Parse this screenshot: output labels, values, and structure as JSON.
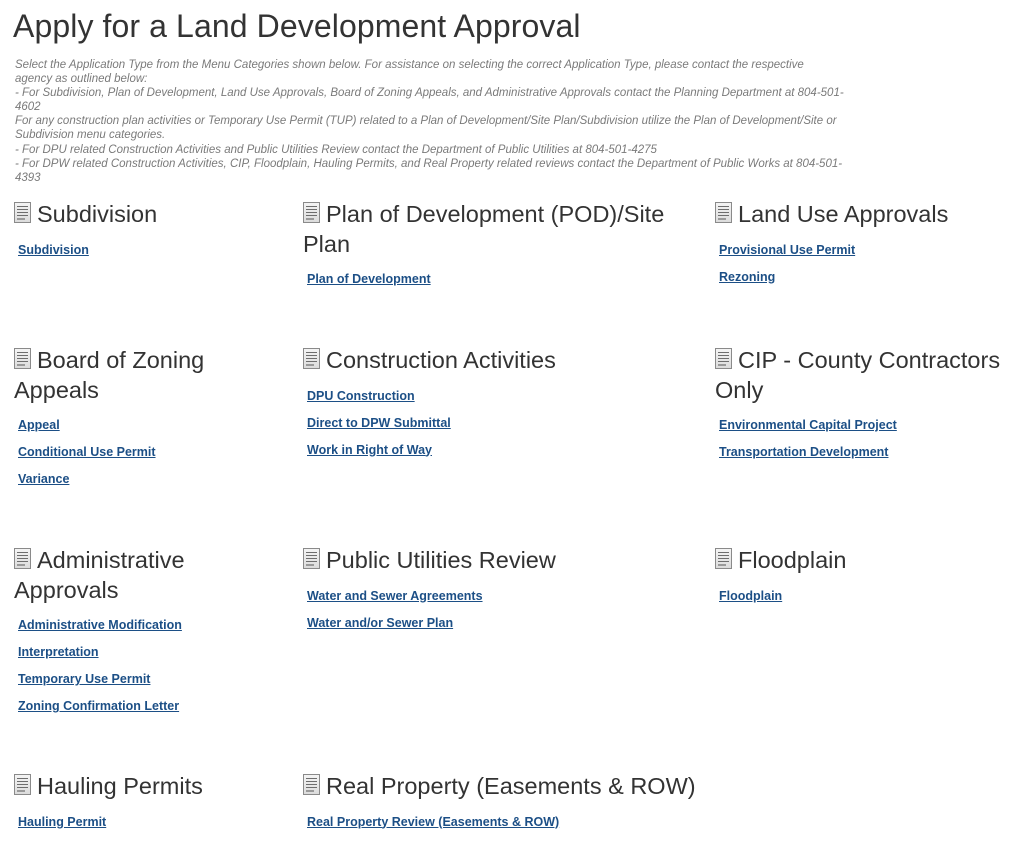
{
  "page": {
    "title": "Apply for a Land Development Approval",
    "instructions": [
      "Select the Application Type from the Menu Categories shown below. For assistance on selecting the correct Application Type, please contact the respective",
      "agency as outlined below:",
      "- For Subdivision, Plan of Development, Land Use Approvals, Board of Zoning Appeals, and Administrative Approvals contact the Planning Department at 804-501-",
      "4602",
      "For any construction plan activities or Temporary Use Permit (TUP) related to a Plan of Development/Site Plan/Subdivision utilize the Plan of Development/Site or",
      "Subdivision menu categories.",
      "- For DPU related Construction Activities and Public Utilities Review contact the Department of Public Utilities at 804-501-4275",
      "- For DPW related Construction Activities, CIP, Floodplain, Hauling Permits, and Real Property related reviews contact the Department of Public Works at 804-501-",
      "4393"
    ]
  },
  "categories": [
    {
      "title": "Subdivision",
      "links": [
        "Subdivision"
      ]
    },
    {
      "title": "Plan of Development (POD)/Site Plan",
      "links": [
        "Plan of Development"
      ]
    },
    {
      "title": "Land Use Approvals",
      "links": [
        "Provisional Use Permit",
        "Rezoning"
      ]
    },
    {
      "title": "Board of Zoning Appeals",
      "links": [
        "Appeal",
        "Conditional Use Permit",
        "Variance"
      ]
    },
    {
      "title": "Construction Activities",
      "links": [
        "DPU Construction",
        "Direct to DPW Submittal",
        "Work in Right of Way"
      ]
    },
    {
      "title": "CIP - County Contractors Only",
      "links": [
        "Environmental Capital Project",
        "Transportation Development"
      ]
    },
    {
      "title": "Administrative Approvals",
      "links": [
        "Administrative Modification",
        "Interpretation",
        "Temporary Use Permit",
        "Zoning Confirmation Letter"
      ]
    },
    {
      "title": "Public Utilities Review",
      "links": [
        "Water and Sewer Agreements",
        "Water and/or Sewer Plan"
      ]
    },
    {
      "title": "Floodplain",
      "links": [
        "Floodplain"
      ]
    },
    {
      "title": "Hauling Permits",
      "links": [
        "Hauling Permit"
      ]
    },
    {
      "title": "Real Property (Easements & ROW)",
      "links": [
        "Real Property Review (Easements & ROW)"
      ]
    }
  ],
  "colors": {
    "link": "#1c4f86",
    "heading": "#333333",
    "instructions": "#7a7a7a"
  },
  "icons": {
    "category": "document-icon"
  }
}
